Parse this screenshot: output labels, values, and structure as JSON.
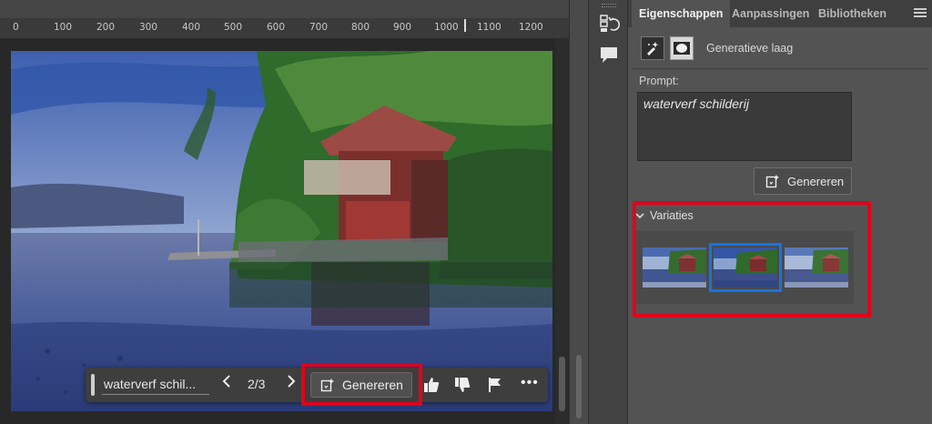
{
  "ruler": {
    "ticks": [
      "0",
      "100",
      "200",
      "300",
      "400",
      "500",
      "600",
      "700",
      "800",
      "900",
      "1000",
      "1100",
      "1200"
    ]
  },
  "taskbar": {
    "prompt_value": "waterverf schil...",
    "prev_icon": "chevron-left-icon",
    "counter": "2/3",
    "next_icon": "chevron-right-icon",
    "generate_label": "Genereren",
    "actions": [
      "thumbs-up-icon",
      "thumbs-down-icon",
      "flag-icon",
      "more-icon"
    ],
    "more_label": "•••"
  },
  "tool_column": {
    "items": [
      "history-icon",
      "comment-icon"
    ]
  },
  "panel": {
    "tabs": [
      {
        "label": "Eigenschappen",
        "active": true
      },
      {
        "label": "Aanpassingen",
        "active": false
      },
      {
        "label": "Bibliotheken",
        "active": false
      }
    ],
    "menu_icon": "panel-menu-icon",
    "layer": {
      "type_icon": "generative-layer-icon",
      "mask_icon": "mask-icon",
      "name": "Generatieve laag"
    },
    "prompt": {
      "label": "Prompt:",
      "value": "waterverf schilderij"
    },
    "generate_label": "Genereren",
    "variations": {
      "title": "Variaties",
      "selected_index": 1,
      "count": 3
    }
  },
  "colors": {
    "accent_highlight": "#e3001b",
    "selection": "#1473e6",
    "panel_bg": "#535353",
    "canvas_bg": "#282828"
  }
}
